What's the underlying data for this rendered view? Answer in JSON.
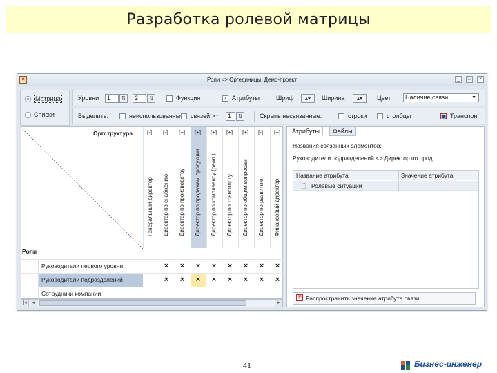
{
  "slide": {
    "title": "Разработка ролевой матрицы",
    "page_number": "41",
    "brand": "Бизнес-инженер"
  },
  "window": {
    "title": "Роли <> Оргединицы. Демо-проект",
    "buttons": [
      "_",
      "□",
      "×"
    ]
  },
  "toolbar": {
    "mode_matrix": "Матрица",
    "mode_lists": "Списки",
    "levels_label": "Уровни",
    "levels_from": "1",
    "levels_to": "2",
    "function_label": "Функция",
    "function_checked": false,
    "attributes_label": "Атрибуты",
    "attributes_checked": true,
    "font_label": "Шрифт",
    "width_label": "Ширина",
    "color_label": "Цвет",
    "color_value": "Наличие связи",
    "highlight_label": "Выделить:",
    "unused_label": "неиспользованные",
    "links_label": "связей >=",
    "links_value": "1",
    "hide_unlinked_label": "Скрыть несвязанные:",
    "rows_label": "строки",
    "cols_label": "столбцы",
    "transpose_label": "Транспон"
  },
  "matrix": {
    "orgstructure_label": "Оргструктура",
    "roles_label": "Роли",
    "columns": [
      {
        "name": "Генеральный директор",
        "expander": "[-]"
      },
      {
        "name": "Директор по снабжению",
        "expander": "[-]"
      },
      {
        "name": "Директор по производству",
        "expander": "[+]"
      },
      {
        "name": "Директор по продажам продукции",
        "expander": "[+]"
      },
      {
        "name": "Директор по комплаенсу (реал.)",
        "expander": "[+]"
      },
      {
        "name": "Директор по транспорту",
        "expander": "[+]"
      },
      {
        "name": "Директор по общим вопросам",
        "expander": "[+]"
      },
      {
        "name": "Директор по развитию",
        "expander": "[-]"
      },
      {
        "name": "Финансовый директор",
        "expander": "[+]"
      }
    ],
    "rows": [
      {
        "name": "Руководители первого уровня",
        "cells": [
          "",
          "×",
          "×",
          "×",
          "×",
          "×",
          "×",
          "×",
          "×"
        ]
      },
      {
        "name": "Руководители подразделений",
        "cells": [
          "",
          "×",
          "×",
          "×",
          "×",
          "×",
          "×",
          "×",
          "×"
        ]
      },
      {
        "name": "Сотрудники компании",
        "cells": [
          "",
          "",
          "",
          "",
          "",
          "",
          "",
          "",
          ""
        ]
      }
    ]
  },
  "right_panel": {
    "tabs": [
      "Атрибуты",
      "Файлы"
    ],
    "linked_elements_label": "Названия связанных элементов:",
    "linked_elements_value": "Руководители подразделений <> Директор по прод",
    "attr_col_name": "Название атрибута",
    "attr_col_value": "Значение атрибута",
    "attributes": [
      {
        "name": "Ролевые ситуации",
        "value": ""
      }
    ],
    "spread_button": "Распространить значение атрибута связи..."
  },
  "colors": {
    "title_bg": "#ffffcc",
    "selected_row": "#b9c9de",
    "selected_col": "#c7d2e2",
    "highlight_cell": "#ffe9a8",
    "brand": "#1f4f9a"
  }
}
